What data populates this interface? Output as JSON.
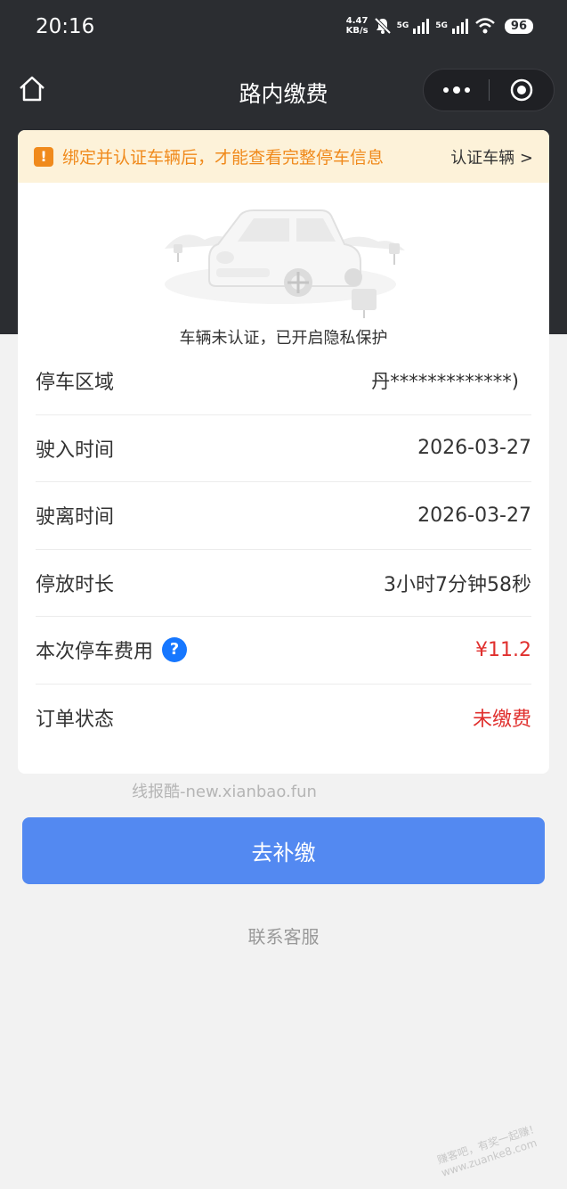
{
  "status_bar": {
    "time": "20:16",
    "net_speed_value": "4.47",
    "net_speed_unit": "KB/s",
    "sim1_label": "5G",
    "sim2_label": "5G",
    "battery": "96"
  },
  "nav": {
    "title": "路内缴费"
  },
  "notice": {
    "icon_char": "!",
    "text": "绑定并认证车辆后，才能查看完整停车信息",
    "link": "认证车辆 >"
  },
  "privacy_text": "车辆未认证，已开启隐私保护",
  "details": [
    {
      "label": "停车区域",
      "value": "丹*************)"
    },
    {
      "label": "驶入时间",
      "value": "2026-03-27"
    },
    {
      "label": "驶离时间",
      "value": "2026-03-27"
    },
    {
      "label": "停放时长",
      "value": "3小时7分钟58秒"
    },
    {
      "label": "本次停车费用",
      "value": "¥11.2",
      "help_icon": "?"
    },
    {
      "label": "订单状态",
      "value": "未缴费"
    }
  ],
  "watermark": "线报酷-new.xianbao.fun",
  "pay_button": "去补缴",
  "customer_service": "联系客服",
  "corner_watermark": "赚客吧，有奖一起赚！www.zuanke8.com",
  "colors": {
    "header_bg": "#2b2d31",
    "notice_orange": "#f08a1c",
    "notice_bg": "#fdf2d9",
    "alert_red": "#e0302e",
    "primary_blue": "#5389f1",
    "help_blue": "#1677ff"
  }
}
